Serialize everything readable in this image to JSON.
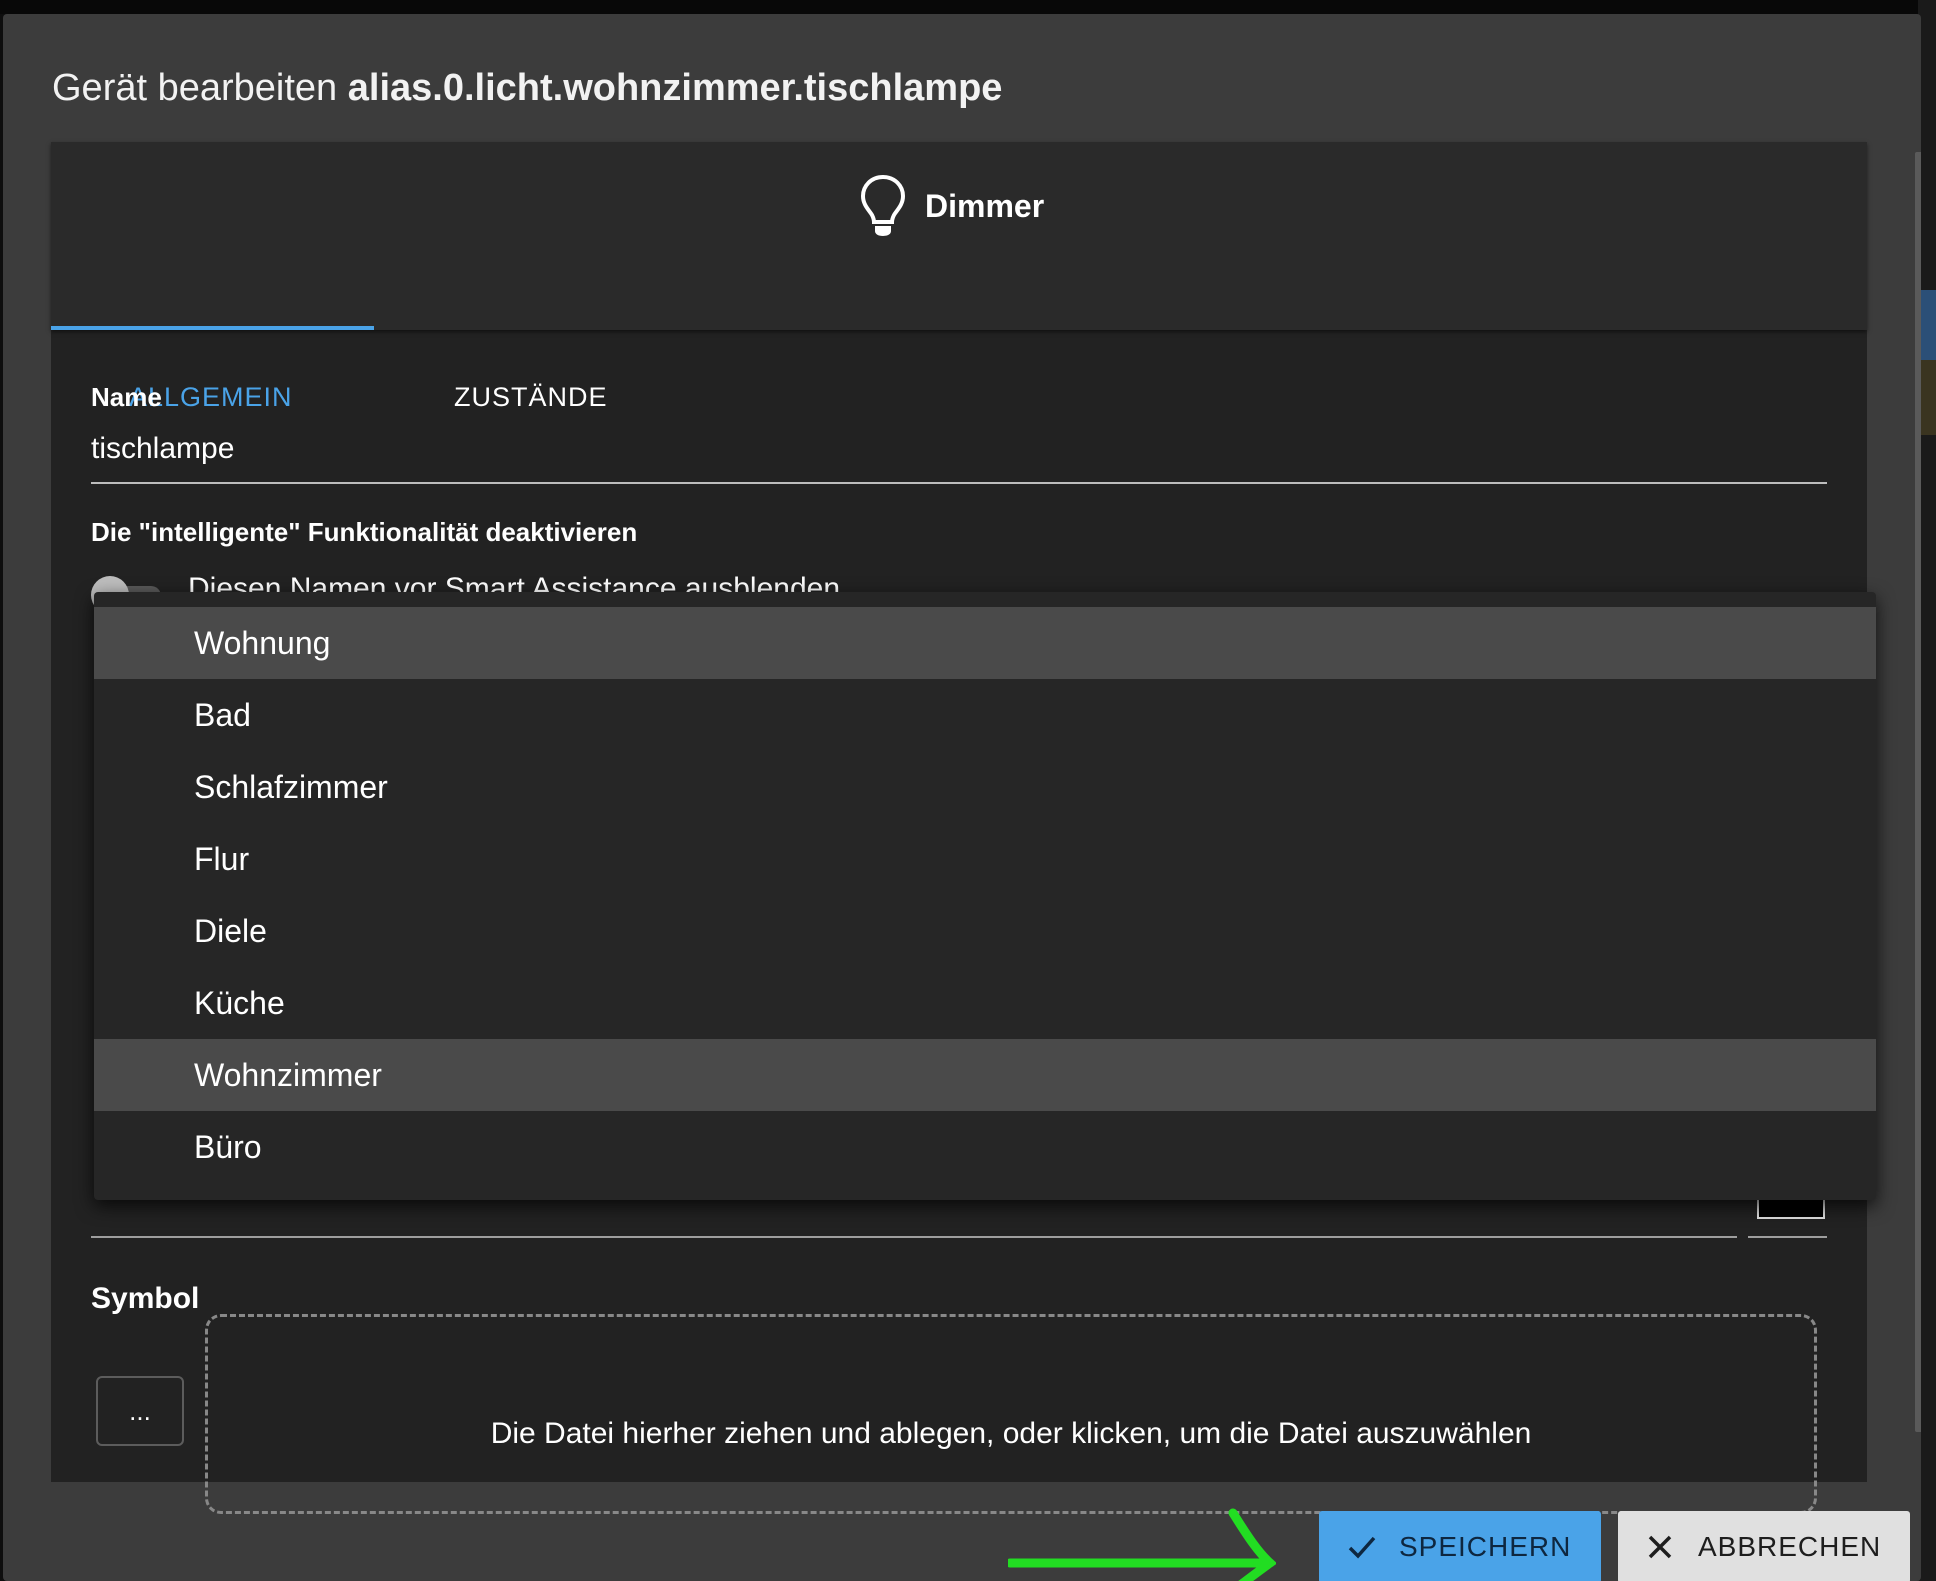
{
  "dialog": {
    "title_prefix": "Gerät bearbeiten",
    "title_id": "alias.0.licht.wohnzimmer.tischlampe"
  },
  "device": {
    "icon": "lightbulb-icon",
    "type_label": "Dimmer"
  },
  "tabs": [
    {
      "label": "ALLGEMEIN",
      "active": true
    },
    {
      "label": "ZUSTÄNDE",
      "active": false
    }
  ],
  "form": {
    "name_label": "Name",
    "name_value": "tischlampe",
    "smart_label": "Die \"intelligente\" Funktionalität deaktivieren",
    "smart_toggle_text": "Diesen Namen vor Smart Assistance ausblenden",
    "smart_toggle_on": false,
    "symbol_label": "Symbol",
    "symbol_button": "...",
    "dropzone_text": "Die Datei hierher ziehen und ablegen, oder klicken, um die Datei auszuwählen"
  },
  "dropdown": {
    "items": [
      {
        "label": "Wohnung"
      },
      {
        "label": "Bad"
      },
      {
        "label": "Schlafzimmer"
      },
      {
        "label": "Flur"
      },
      {
        "label": "Diele"
      },
      {
        "label": "Küche"
      },
      {
        "label": "Wohnzimmer"
      },
      {
        "label": "Büro"
      }
    ],
    "highlighted": [
      "Wohnung",
      "Wohnzimmer"
    ]
  },
  "buttons": {
    "save": "SPEICHERN",
    "cancel": "ABBRECHEN"
  },
  "colors": {
    "accent": "#4aa3e8",
    "annotation_arrow": "#22dd22",
    "dialog_bg": "#3c3c3c",
    "panel_bg": "#222222"
  }
}
